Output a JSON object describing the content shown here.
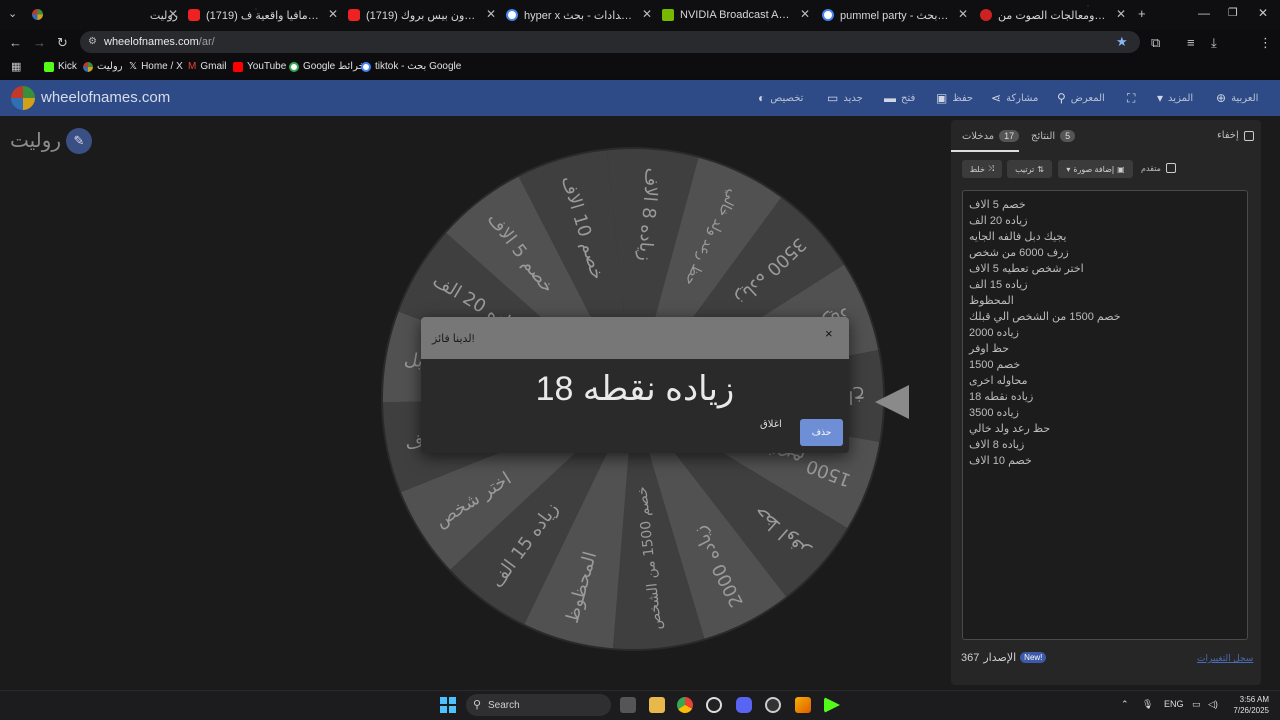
{
  "browser": {
    "tabs": [
      {
        "title": "روليت",
        "favicon_color": "#d24"
      },
      {
        "title": "(1719) سويت أكبر مافيا واقعية ف",
        "favicon_color": "#e22"
      },
      {
        "title": "(1719) نطق أغنية ون بيس بروك",
        "favicon_color": "#e22"
      },
      {
        "title": "hyper x افضل اعدادات - بحث",
        "favicon_color": "#4285f4"
      },
      {
        "title": "NVIDIA Broadcast App: AI-Powe",
        "favicon_color": "#76b900"
      },
      {
        "title": "pummel party - بحث Google",
        "favicon_color": "#4285f4"
      },
      {
        "title": "مضخمات ومعالجات الصوت من",
        "favicon_color": "#c22"
      }
    ],
    "new_tab": "+",
    "url_domain": "wheelofnames.com",
    "url_path": "/ar/",
    "bookmarks": [
      {
        "label": "Kick",
        "color": "#53fc18"
      },
      {
        "label": "روليت",
        "color": "#d4a017"
      },
      {
        "label": "Home / X",
        "color": "#111"
      },
      {
        "label": "Gmail",
        "color": "#ea4335"
      },
      {
        "label": "YouTube",
        "color": "#f00"
      },
      {
        "label": "Google خرائط",
        "color": "#34a853"
      },
      {
        "label": "tiktok - بحث Google",
        "color": "#4285f4"
      }
    ]
  },
  "app": {
    "brand": "wheelofnames.com",
    "nav": {
      "customize": "تخصيص",
      "new": "جديد",
      "open": "فتح",
      "save": "حفظ",
      "share": "مشاركة",
      "gallery": "المعرض",
      "more": "المزيد",
      "language": "العربية"
    },
    "wheel_title": "روليت"
  },
  "panel": {
    "tab_entries": "مدخلات",
    "entries_count": "17",
    "tab_results": "النتائج",
    "results_count": "5",
    "hide_label": "إخفاء",
    "shuffle": "خلط",
    "sort": "ترتيب",
    "add_image": "إضافة صورة",
    "advanced": "متقدم",
    "entries": [
      "خصم 5 الاف",
      "زياده 20 الف",
      "يجيك دبل فالفه الجايه",
      "زرف 6000 من شخص",
      "اختر شخص تعطيه 5 الاف",
      "زياده 15 الف",
      "المحظوظ",
      "خصم 1500 من الشخص الي قبلك",
      "زياده 2000",
      "حظ اوفر",
      "خصم 1500",
      "محاوله اخرى",
      "زياده نقطه 18",
      "زياده 3500",
      "حظ رعد ولد خالي",
      "زياده 8 الاف",
      "خصم 10 الاف"
    ],
    "version_label": "الإصدار",
    "version_number": "367",
    "new_badge": "New!",
    "changelog": "سجل التغييرات"
  },
  "wheel": {
    "segment_colors": [
      "#3f3f3f",
      "#515151"
    ],
    "visible_labels": [
      "زياده 8 الاف",
      "حظ رعد ولد خالي",
      "زياده 3500",
      "زياد",
      "محاوله اخ",
      "خصم 1500",
      "حظ اوفر",
      "زياده 2000",
      "خصم 1500 من الشخص",
      "المحظوظ",
      "زياده 15 الف",
      "اختر شخص",
      "زرف",
      "يجيك دبل",
      "زياده 20 الف",
      "خصم 5 الاف",
      "خصم 10 الاف"
    ]
  },
  "dialog": {
    "title": "لدينا فائز!",
    "close": "×",
    "winner": "زياده نقطه 18",
    "dismiss": "اغلاق",
    "remove": "حذف"
  },
  "taskbar": {
    "search": "Search",
    "lang": "ENG",
    "time": "3:56 AM",
    "date": "7/26/2025"
  }
}
